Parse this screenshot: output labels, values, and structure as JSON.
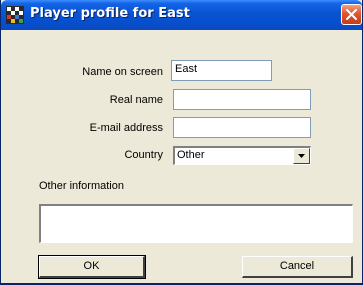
{
  "window": {
    "title": "Player profile for East"
  },
  "form": {
    "name_on_screen": {
      "label": "Name on screen",
      "value": "East"
    },
    "real_name": {
      "label": "Real name",
      "value": ""
    },
    "email": {
      "label": "E-mail address",
      "value": ""
    },
    "country": {
      "label": "Country",
      "value": "Other"
    },
    "other_info": {
      "label": "Other information",
      "value": ""
    }
  },
  "buttons": {
    "ok": "OK",
    "cancel": "Cancel"
  },
  "icons": {
    "app": "game-board-icon",
    "close": "close-icon",
    "dropdown": "chevron-down-icon"
  },
  "colors": {
    "titlebar": "#0a55d4",
    "close_button": "#e05532",
    "dialog_face": "#ece9d8"
  }
}
